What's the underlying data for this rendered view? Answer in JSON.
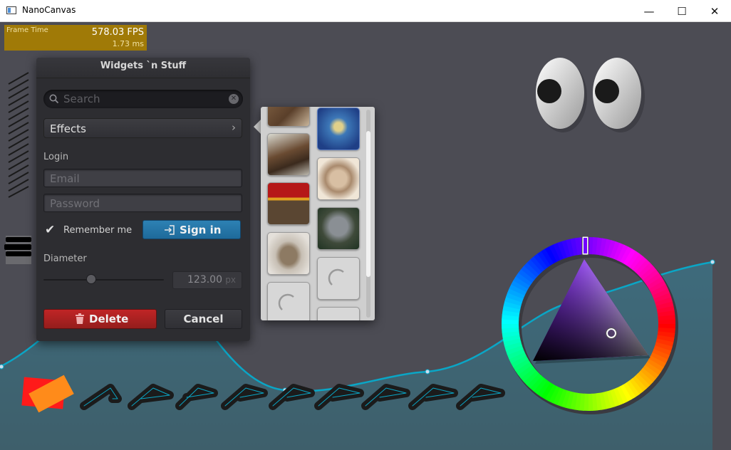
{
  "window": {
    "title": "NanoCanvas",
    "minimize_glyph": "—",
    "maximize_glyph": "☐",
    "close_glyph": "✕"
  },
  "fps_graph": {
    "label": "Frame Time",
    "fps": "578.03 FPS",
    "ms": "1.73 ms",
    "color": "#a07a07"
  },
  "panel": {
    "title": "Widgets `n Stuff",
    "search": {
      "placeholder": "Search",
      "value": ""
    },
    "effects_label": "Effects",
    "login_label": "Login",
    "email_placeholder": "Email",
    "password_placeholder": "Password",
    "remember_me": {
      "label": "Remember me",
      "checked": true
    },
    "signin_label": "Sign in",
    "diameter_label": "Diameter",
    "diameter": {
      "value": "123.00",
      "unit": "px",
      "slider_fraction": 0.4
    },
    "delete_label": "Delete",
    "cancel_label": "Cancel",
    "accent_color": "#1f6ea0",
    "delete_color": "#b02525"
  },
  "image_popup": {
    "thumbnails": [
      {
        "subject": "squirrel"
      },
      {
        "subject": "jellyfish"
      },
      {
        "subject": "shrew"
      },
      {
        "subject": "rabbit"
      },
      {
        "subject": "kitten"
      },
      {
        "subject": "bear-cub"
      },
      {
        "subject": "tortoise"
      },
      {
        "subject": "loading-icon"
      },
      {
        "subject": "loading-icon"
      },
      {
        "subject": "loading-icon"
      }
    ]
  },
  "color_wheel": {
    "hue_color": "#7a28e0",
    "selected_color": "#c9b6e8"
  }
}
